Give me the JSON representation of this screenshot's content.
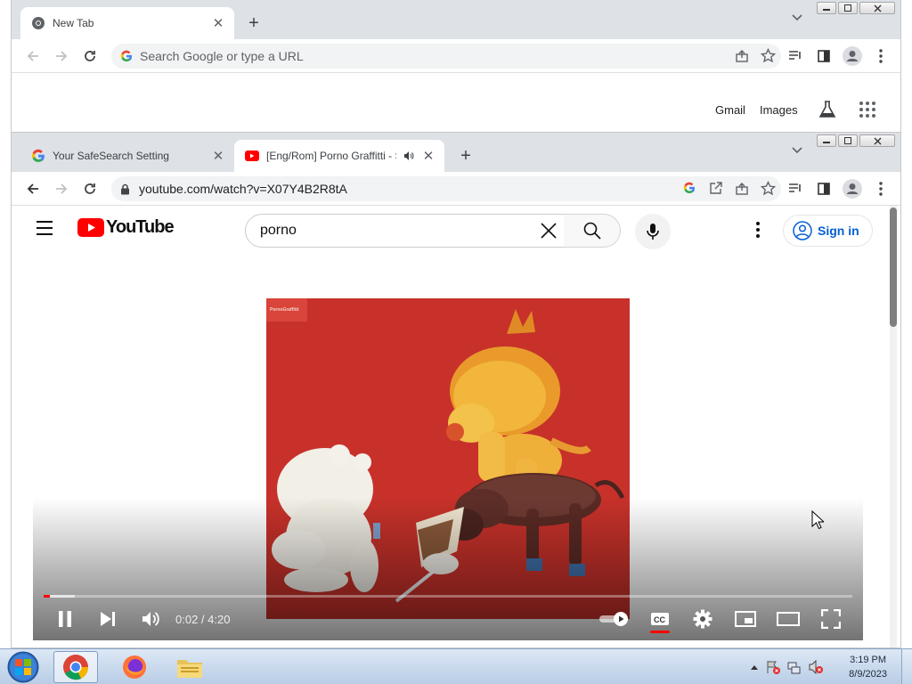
{
  "back_window": {
    "tab_title": "New Tab",
    "omnibox_placeholder": "Search Google or type a URL",
    "ntp_links": {
      "gmail": "Gmail",
      "images": "Images"
    }
  },
  "front_window": {
    "tabs": [
      {
        "title": "Your SafeSearch Setting"
      },
      {
        "title": "[Eng/Rom] Porno Graffitti - S"
      }
    ],
    "url": "youtube.com/watch?v=X07Y4B2R8tA"
  },
  "youtube": {
    "logo_text": "YouTube",
    "search_query": "porno",
    "signin_label": "Sign in",
    "video_badge": "PornoGraffitti",
    "time_display": "0:02 / 4:20",
    "progress": {
      "played_pct": 0.8,
      "buffered_pct": 3.8
    }
  },
  "taskbar": {
    "time": "3:19 PM",
    "date": "8/9/2023"
  },
  "colors": {
    "youtube_red": "#ff0000",
    "link_blue": "#065fd4",
    "album_bg": "#c7312a"
  }
}
